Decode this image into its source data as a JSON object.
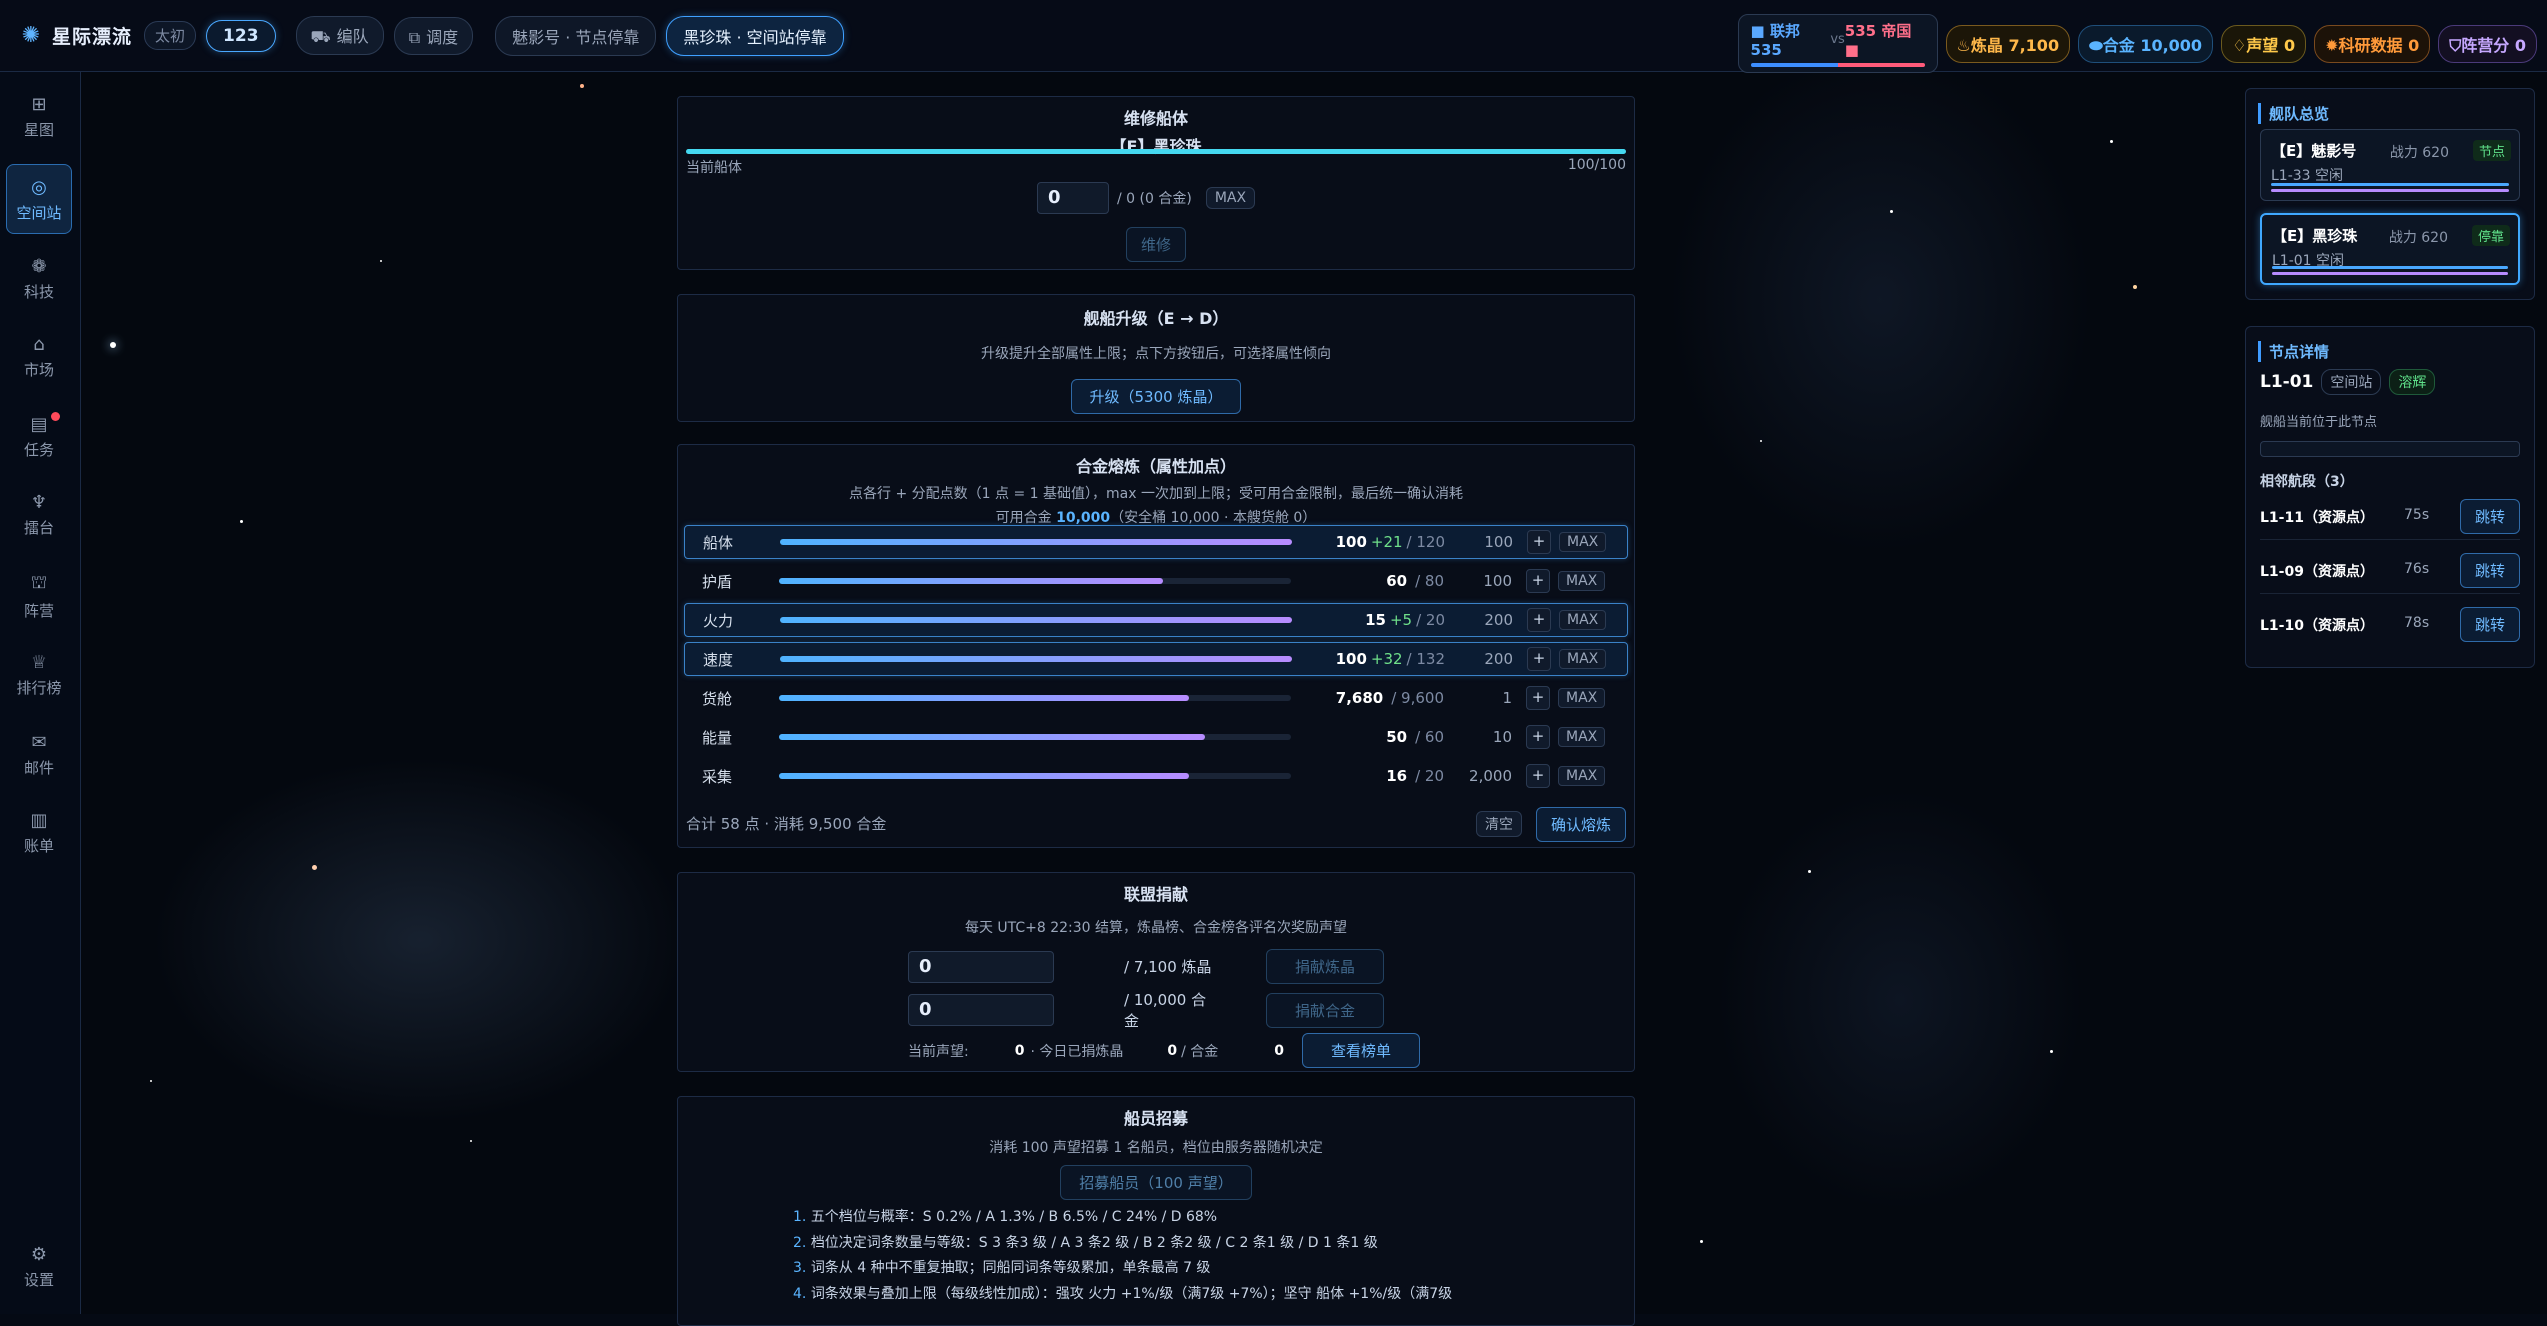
{
  "app": {
    "title": "星际漂流",
    "server": "太初",
    "number": "123"
  },
  "topbar": {
    "fleet_btn": "编队",
    "dispatch_btn": "调度",
    "ship_tabs": [
      {
        "label": "魅影号 · 节点停靠",
        "active": false
      },
      {
        "label": "黑珍珠 · 空间站停靠",
        "active": true
      }
    ],
    "versus": {
      "left_label": "联邦",
      "left_value": "535",
      "vs": "vs",
      "right_value": "535",
      "right_label": "帝国"
    },
    "resources": {
      "crystal": "炼晶 7,100",
      "alloy": "合金 10,000",
      "prestige": "声望 0",
      "research": "科研数据 0",
      "camp": "阵营分 0"
    }
  },
  "sidebar": {
    "items": [
      {
        "label": "星图",
        "icon": "map-icon",
        "active": false
      },
      {
        "label": "空间站",
        "icon": "station-icon",
        "active": true
      },
      {
        "label": "科技",
        "icon": "tech-icon",
        "active": false
      },
      {
        "label": "市场",
        "icon": "market-icon",
        "active": false
      },
      {
        "label": "任务",
        "icon": "task-icon",
        "active": false,
        "badge": true
      },
      {
        "label": "擂台",
        "icon": "trophy-icon",
        "active": false
      },
      {
        "label": "阵营",
        "icon": "camp-icon",
        "active": false
      },
      {
        "label": "排行榜",
        "icon": "crown-icon",
        "active": false
      },
      {
        "label": "邮件",
        "icon": "mail-icon",
        "active": false
      },
      {
        "label": "账单",
        "icon": "bill-icon",
        "active": false
      }
    ],
    "settings": "设置"
  },
  "repair": {
    "title": "维修船体",
    "ship": "【E】黑珍珠",
    "hull_label": "当前船体",
    "hull_value": "100/100",
    "hull_fraction": 1.0,
    "input_value": "0",
    "cost_text": "/ 0 (0 合金)",
    "max_btn": "MAX",
    "repair_btn": "维修"
  },
  "upgrade": {
    "title": "舰船升级（E → D）",
    "desc": "升级提升全部属性上限；点下方按钮后，可选择属性倾向",
    "button": "升级（5300 炼晶）"
  },
  "alloy_refine": {
    "title": "合金熔炼（属性加点）",
    "desc1": "点各行 + 分配点数（1 点 = 1 基础值），max 一次加到上限；受可用合金限制，最后统一确认消耗",
    "desc2_prefix": "可用合金",
    "desc2_value": "10,000",
    "desc2_suffix": "（安全桶 10,000 · 本艘货舱 0）",
    "plus": "+",
    "max": "MAX",
    "rows": [
      {
        "name": "船体",
        "current": "100",
        "add": "+21",
        "max": "/ 120",
        "cost": "100",
        "fill": 1.0,
        "highlight": true
      },
      {
        "name": "护盾",
        "current": "60",
        "add": "",
        "max": "/ 80",
        "cost": "100",
        "fill": 0.75,
        "highlight": false
      },
      {
        "name": "火力",
        "current": "15",
        "add": "+5",
        "max": "/ 20",
        "cost": "200",
        "fill": 1.0,
        "highlight": true
      },
      {
        "name": "速度",
        "current": "100",
        "add": "+32",
        "max": "/ 132",
        "cost": "200",
        "fill": 1.0,
        "highlight": true
      },
      {
        "name": "货舱",
        "current": "7,680",
        "add": "",
        "max": "/ 9,600",
        "cost": "1",
        "fill": 0.8,
        "highlight": false
      },
      {
        "name": "能量",
        "current": "50",
        "add": "",
        "max": "/ 60",
        "cost": "10",
        "fill": 0.833,
        "highlight": false
      },
      {
        "name": "采集",
        "current": "16",
        "add": "",
        "max": "/ 20",
        "cost": "2,000",
        "fill": 0.8,
        "highlight": false
      }
    ],
    "summary": "合计 58 点 · 消耗 9,500 合金",
    "clear_btn": "清空",
    "confirm_btn": "确认熔炼"
  },
  "alliance": {
    "title": "联盟捐献",
    "desc": "每天 UTC+8 22:30 结算，炼晶榜、合金榜各评名次奖励声望",
    "crystal_input": "0",
    "crystal_text": "/ 7,100 炼晶",
    "crystal_btn": "捐献炼晶",
    "alloy_input": "0",
    "alloy_text": "/ 10,000 合金",
    "alloy_btn": "捐献合金",
    "prestige_label": "当前声望:",
    "prestige_value": "0",
    "today_label": "· 今日已捐炼晶",
    "today_crystal": "0",
    "today_alloy_label": "/ 合金",
    "today_alloy": "0",
    "rank_btn": "查看榜单"
  },
  "crew": {
    "title": "船员招募",
    "desc": "消耗 100 声望招募 1 名船员，档位由服务器随机决定",
    "button": "招募船员（100 声望）",
    "rules": [
      "五个档位与概率：S 0.2% / A 1.3% / B 6.5% / C 24% / D 68%",
      "档位决定词条数量与等级：S 3 条3 级 / A 3 条2 级 / B 2 条2 级 / C 2 条1 级 / D 1 条1 级",
      "词条从 4 种中不重复抽取；同船同词条等级累加，单条最高 7 级",
      "词条效果与叠加上限（每级线性加成）：强攻 火力 +1%/级（满7级 +7%）；坚守 船体 +1%/级（满7级"
    ]
  },
  "fleet_overview": {
    "title": "舰队总览",
    "cards": [
      {
        "name": "【E】魅影号",
        "power": "战力 620",
        "tag": "节点",
        "loc": "L1-33 空闲",
        "selected": false
      },
      {
        "name": "【E】黑珍珠",
        "power": "战力 620",
        "tag": "停靠",
        "loc": "L1-01 空闲",
        "selected": true
      }
    ]
  },
  "node_detail": {
    "title": "节点详情",
    "node_id": "L1-01",
    "tag1": "空间站",
    "tag2": "溶辉",
    "desc": "舰船当前位于此节点",
    "neighbors_title": "相邻航段（3）",
    "neighbors": [
      {
        "name": "L1-11（资源点）",
        "time": "75s",
        "btn": "跳转"
      },
      {
        "name": "L1-09（资源点）",
        "time": "76s",
        "btn": "跳转"
      },
      {
        "name": "L1-10（资源点）",
        "time": "78s",
        "btn": "跳转"
      }
    ]
  }
}
